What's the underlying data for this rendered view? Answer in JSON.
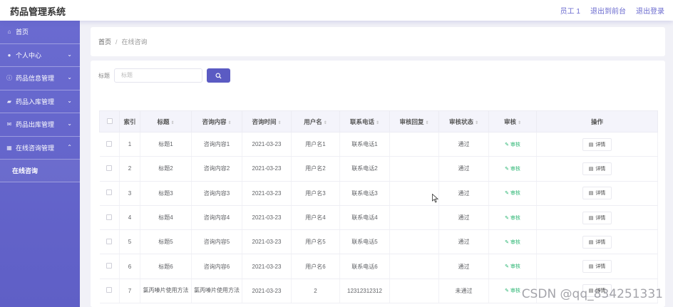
{
  "header": {
    "title": "药品管理系统",
    "user": "员工 1",
    "to_front": "退出到前台",
    "logout": "退出登录"
  },
  "sidebar": {
    "items": [
      {
        "label": "首页",
        "icon": "home-icon"
      },
      {
        "label": "个人中心",
        "icon": "user-icon"
      },
      {
        "label": "药品信息管理",
        "icon": "info-icon"
      },
      {
        "label": "药品入库管理",
        "icon": "inbox-icon"
      },
      {
        "label": "药品出库管理",
        "icon": "mail-icon"
      },
      {
        "label": "在线咨询管理",
        "icon": "grid-icon"
      }
    ],
    "sub_item": "在线咨询"
  },
  "breadcrumb": {
    "home": "首页",
    "sep": "/",
    "current": "在线咨询"
  },
  "search": {
    "label": "标题",
    "placeholder": "标题"
  },
  "table": {
    "headers": [
      "索引",
      "标题",
      "咨询内容",
      "咨询时间",
      "用户名",
      "联系电话",
      "审核回复",
      "审核状态",
      "审核",
      "操作"
    ],
    "audit_label": "审核",
    "detail_label": "详情",
    "rows": [
      {
        "index": "1",
        "title": "标题1",
        "content": "咨询内容1",
        "time": "2021-03-23",
        "user": "用户名1",
        "phone": "联系电话1",
        "reply": "",
        "status": "通过"
      },
      {
        "index": "2",
        "title": "标题2",
        "content": "咨询内容2",
        "time": "2021-03-23",
        "user": "用户名2",
        "phone": "联系电话2",
        "reply": "",
        "status": "通过"
      },
      {
        "index": "3",
        "title": "标题3",
        "content": "咨询内容3",
        "time": "2021-03-23",
        "user": "用户名3",
        "phone": "联系电话3",
        "reply": "",
        "status": "通过"
      },
      {
        "index": "4",
        "title": "标题4",
        "content": "咨询内容4",
        "time": "2021-03-23",
        "user": "用户名4",
        "phone": "联系电话4",
        "reply": "",
        "status": "通过"
      },
      {
        "index": "5",
        "title": "标题5",
        "content": "咨询内容5",
        "time": "2021-03-23",
        "user": "用户名5",
        "phone": "联系电话5",
        "reply": "",
        "status": "通过"
      },
      {
        "index": "6",
        "title": "标题6",
        "content": "咨询内容6",
        "time": "2021-03-23",
        "user": "用户名6",
        "phone": "联系电话6",
        "reply": "",
        "status": "通过"
      },
      {
        "index": "7",
        "title": "氯丙嗪片使用方法",
        "content": "氯丙嗪片使用方法",
        "time": "2021-03-23",
        "user": "2",
        "phone": "12312312312",
        "reply": "",
        "status": "未通过"
      }
    ]
  },
  "watermark": "CSDN @qq_834251331",
  "colors": {
    "accent": "#5b5bc3",
    "sidebar": "#6364cc",
    "audit_green": "#2bb673"
  }
}
